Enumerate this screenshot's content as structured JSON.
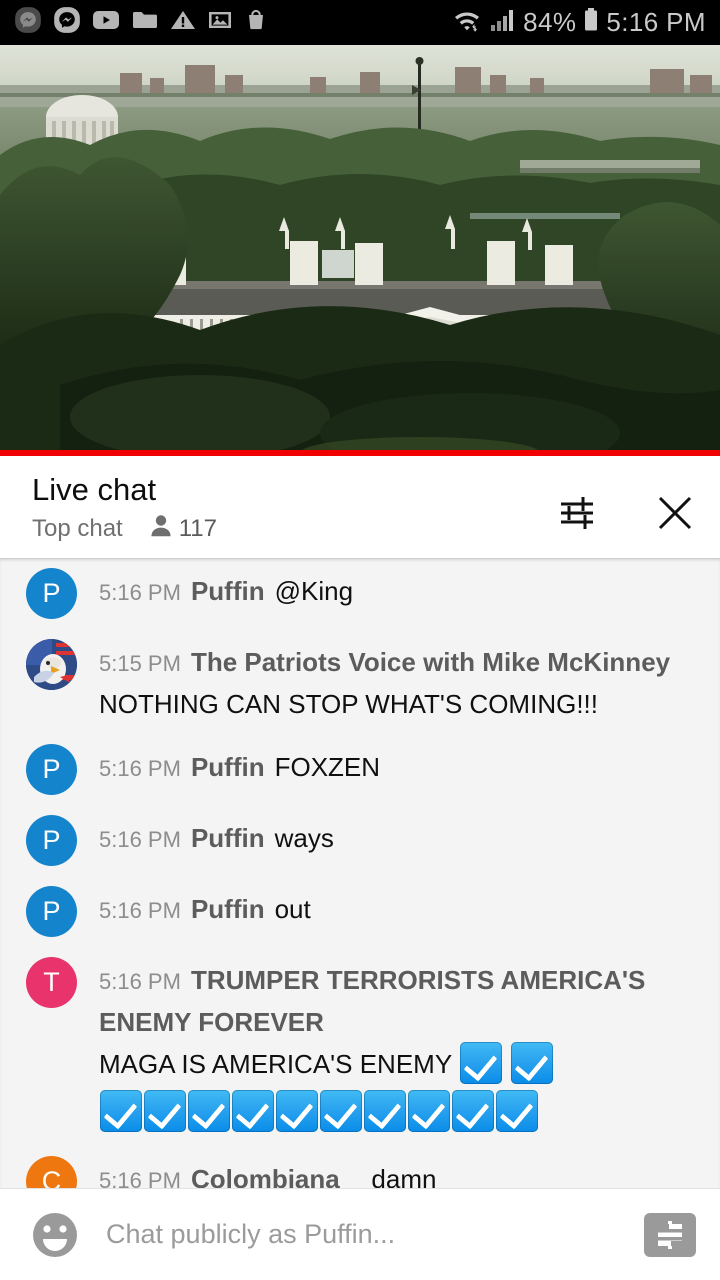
{
  "statusbar": {
    "icons": [
      "messenger-dark-icon",
      "messenger-light-icon",
      "youtube-icon",
      "folder-icon",
      "warning-icon",
      "image-icon",
      "shopping-bag-icon"
    ],
    "wifi_icon": "wifi-icon",
    "signal_icon": "signal-bars-icon",
    "battery_percent": "84%",
    "battery_icon": "battery-icon",
    "clock": "5:16 PM"
  },
  "video": {
    "name": "white-house-live-stream",
    "progress_color": "#f00000",
    "progress_percent": 100
  },
  "chat_header": {
    "title": "Live chat",
    "mode": "Top chat",
    "viewer_count": "117",
    "viewer_icon": "person-icon",
    "settings_icon": "tune-settings-icon",
    "close_icon": "close-icon"
  },
  "messages": [
    {
      "avatar_letter": "P",
      "avatar_color": "#1484cc",
      "avatar_type": "letter",
      "time": "5:16 PM",
      "author": "Puffin",
      "text": "@King",
      "emoji_row": 0
    },
    {
      "avatar_letter": "",
      "avatar_color": "#2d4f8e",
      "avatar_type": "image",
      "time": "5:15 PM",
      "author": "The Patriots Voice with Mike McKinney",
      "text": "NOTHING CAN STOP WHAT'S COMING!!!",
      "wrap": true,
      "emoji_row": 0
    },
    {
      "avatar_letter": "P",
      "avatar_color": "#1484cc",
      "avatar_type": "letter",
      "time": "5:16 PM",
      "author": "Puffin",
      "text": "FOXZEN",
      "emoji_row": 0
    },
    {
      "avatar_letter": "P",
      "avatar_color": "#1484cc",
      "avatar_type": "letter",
      "time": "5:16 PM",
      "author": "Puffin",
      "text": "ways",
      "emoji_row": 0
    },
    {
      "avatar_letter": "P",
      "avatar_color": "#1484cc",
      "avatar_type": "letter",
      "time": "5:16 PM",
      "author": "Puffin",
      "text": "out",
      "emoji_row": 0
    },
    {
      "avatar_letter": "T",
      "avatar_color": "#e8336d",
      "avatar_type": "letter",
      "time": "5:16 PM",
      "author": "TRUMPER TERRORISTS AMERICA'S ENEMY FOREVER",
      "text": "MAGA IS AMERICA'S ENEMY",
      "wrap": true,
      "emoji_inline": 2,
      "emoji_row": 10,
      "emoji_name": "white-check-mark-emoji"
    },
    {
      "avatar_letter": "C",
      "avatar_color": "#ef7710",
      "avatar_type": "letter",
      "time": "5:16 PM",
      "author": "Colombiana _",
      "text": "damn",
      "emoji_row": 0
    }
  ],
  "input_bar": {
    "emoji_icon": "emoji-smiley-icon",
    "placeholder": "Chat publicly as Puffin...",
    "value": "",
    "superchat_icon": "dollar-banknote-icon"
  }
}
